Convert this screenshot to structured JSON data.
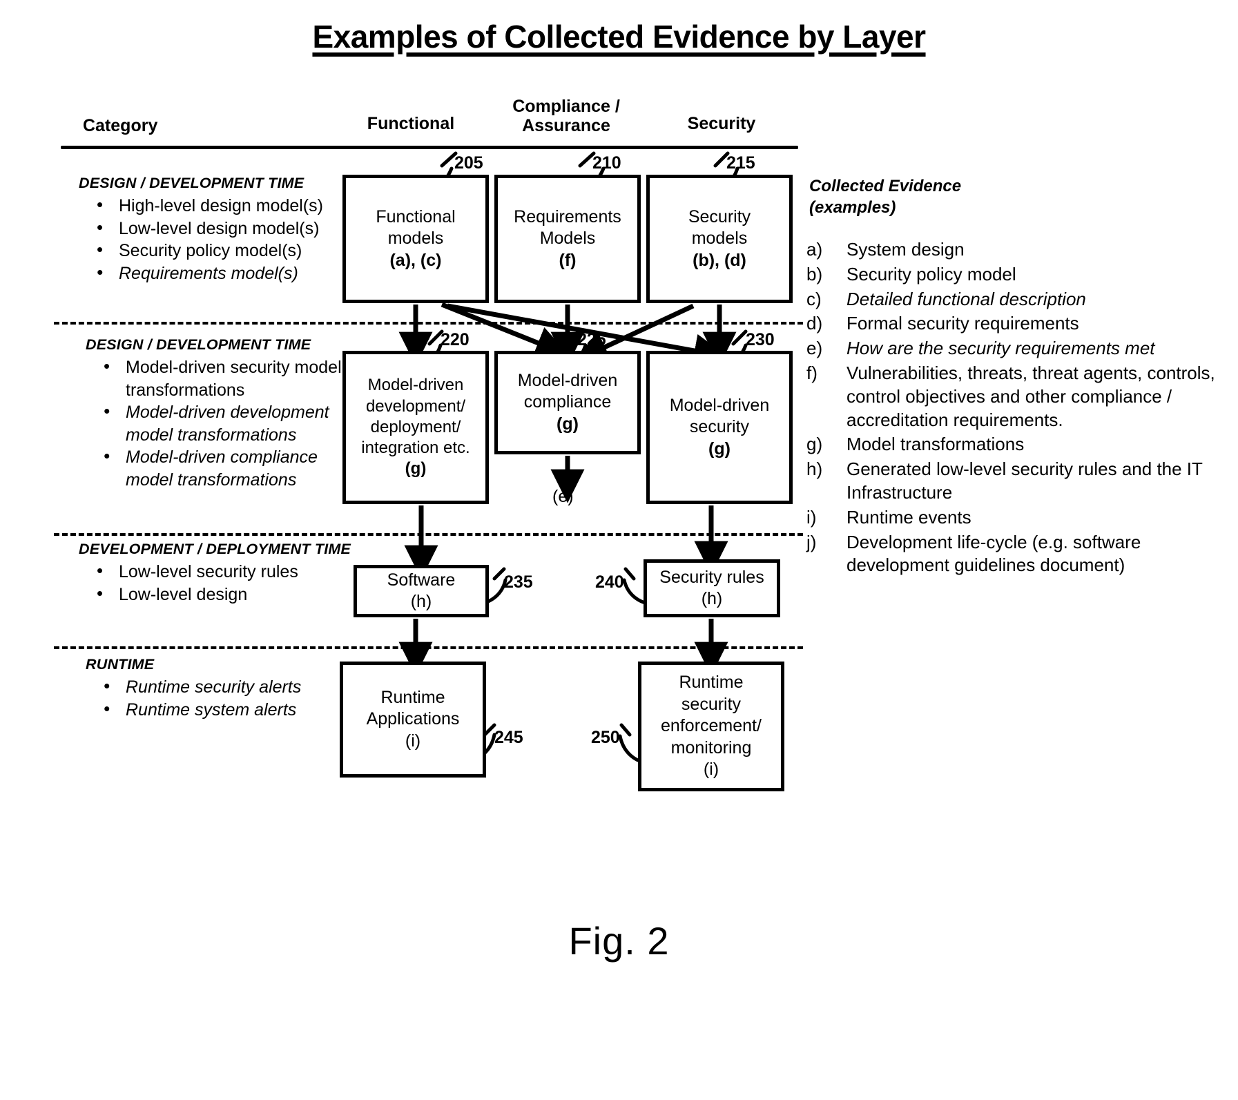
{
  "title": "Examples of Collected Evidence by Layer",
  "figure_caption": "Fig. 2",
  "headers": {
    "category": "Category",
    "functional": "Functional",
    "compliance_line1": "Compliance /",
    "compliance_line2": "Assurance",
    "security": "Security"
  },
  "categories": [
    {
      "title": "DESIGN / DEVELOPMENT TIME",
      "items": [
        "High-level design model(s)",
        "Low-level design model(s)",
        "Security policy model(s)",
        "Requirements model(s)"
      ]
    },
    {
      "title": "DESIGN / DEVELOPMENT TIME",
      "items": [
        "Model-driven security model transformations",
        "Model-driven development model transformations",
        "Model-driven compliance model transformations"
      ]
    },
    {
      "title": "DEVELOPMENT / DEPLOYMENT TIME",
      "items": [
        "Low-level security rules",
        "Low-level design"
      ]
    },
    {
      "title": "RUNTIME",
      "items": [
        "Runtime security alerts",
        "Runtime system alerts"
      ]
    }
  ],
  "boxes": {
    "b205": {
      "ref": "205",
      "lines": [
        "Functional",
        "models",
        "(a), (c)"
      ]
    },
    "b210": {
      "ref": "210",
      "lines": [
        "Requirements",
        "Models",
        "(f)"
      ]
    },
    "b215": {
      "ref": "215",
      "lines": [
        "Security",
        "models",
        "(b), (d)"
      ]
    },
    "b220": {
      "ref": "220",
      "lines": [
        "Model-driven",
        "development/",
        "deployment/",
        "integration etc.",
        "(g)"
      ]
    },
    "b225": {
      "ref": "225",
      "lines": [
        "Model-driven",
        "compliance",
        "(g)"
      ]
    },
    "b230": {
      "ref": "230",
      "lines": [
        "Model-driven",
        "security",
        "(g)"
      ]
    },
    "b235": {
      "ref": "235",
      "lines": [
        "Software",
        "(h)"
      ]
    },
    "b240": {
      "ref": "240",
      "lines": [
        "Security rules",
        "(h)"
      ]
    },
    "b245": {
      "ref": "245",
      "lines": [
        "Runtime",
        "Applications",
        "(i)"
      ]
    },
    "b250": {
      "ref": "250",
      "lines": [
        "Runtime",
        "security",
        "enforcement/",
        "monitoring",
        "(i)"
      ]
    }
  },
  "annotations": {
    "label_e": "(e)"
  },
  "legend": {
    "title_line1": "Collected Evidence",
    "title_line2": "(examples)",
    "items": [
      {
        "key": "a)",
        "text": "System design"
      },
      {
        "key": "b)",
        "text": "Security policy model"
      },
      {
        "key": "c)",
        "text": "Detailed functional description"
      },
      {
        "key": "d)",
        "text": "Formal security requirements"
      },
      {
        "key": "e)",
        "text": "How are the security requirements met"
      },
      {
        "key": "f)",
        "text": "Vulnerabilities, threats, threat agents, controls, control objectives and other compliance / accreditation requirements."
      },
      {
        "key": "g)",
        "text": "Model transformations"
      },
      {
        "key": "h)",
        "text": "Generated low-level security rules and the IT Infrastructure"
      },
      {
        "key": "i)",
        "text": "Runtime events"
      },
      {
        "key": "j)",
        "text": "Development life-cycle (e.g. software development guidelines document)"
      }
    ]
  }
}
